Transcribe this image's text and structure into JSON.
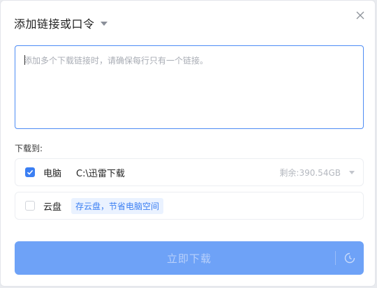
{
  "dialog": {
    "title": "添加链接或口令",
    "icons": {
      "title_caret": "chevron-down-icon",
      "close": "close-icon"
    }
  },
  "link_input": {
    "placeholder": "添加多个下载链接时，请确保每行只有一个链接。",
    "value": ""
  },
  "download_to": {
    "label": "下载到:",
    "options": [
      {
        "name": "电脑",
        "checked": true,
        "path": "C:\\迅雷下载",
        "space": "剩余:390.54GB"
      },
      {
        "name": "云盘",
        "checked": false,
        "tag": "存云盘，节省电脑空间"
      }
    ]
  },
  "action": {
    "label": "立即下载",
    "icons": {
      "schedule": "clock-icon"
    }
  },
  "colors": {
    "accent": "#3b7ff3",
    "primary_button": "#6ea2f7",
    "input_border": "#4d8cf5",
    "tag_bg": "#eaf2ff"
  }
}
